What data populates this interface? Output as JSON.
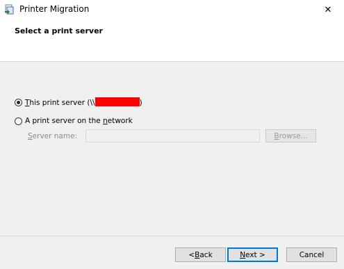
{
  "window": {
    "title": "Printer Migration",
    "close_glyph": "✕"
  },
  "header": {
    "title": "Select a print server"
  },
  "options": {
    "this_server": {
      "pre": "",
      "accel": "T",
      "post": "his print server (\\\\",
      "close": ")",
      "selected": true
    },
    "network_server": {
      "pre": "A print server on the ",
      "accel": "n",
      "post": "etwork",
      "selected": false
    }
  },
  "server_name": {
    "label_accel": "S",
    "label_rest": "erver name:",
    "value": ""
  },
  "browse": {
    "label_accel": "B",
    "label_rest": "rowse..."
  },
  "footer": {
    "back": {
      "pre": "< ",
      "accel": "B",
      "post": "ack"
    },
    "next": {
      "pre": "",
      "accel": "N",
      "post": "ext >"
    },
    "cancel": "Cancel"
  },
  "colors": {
    "accent": "#0078d7",
    "redaction": "#ff0000"
  },
  "icons": {
    "app": "printer-migration-icon",
    "close": "close-icon"
  }
}
